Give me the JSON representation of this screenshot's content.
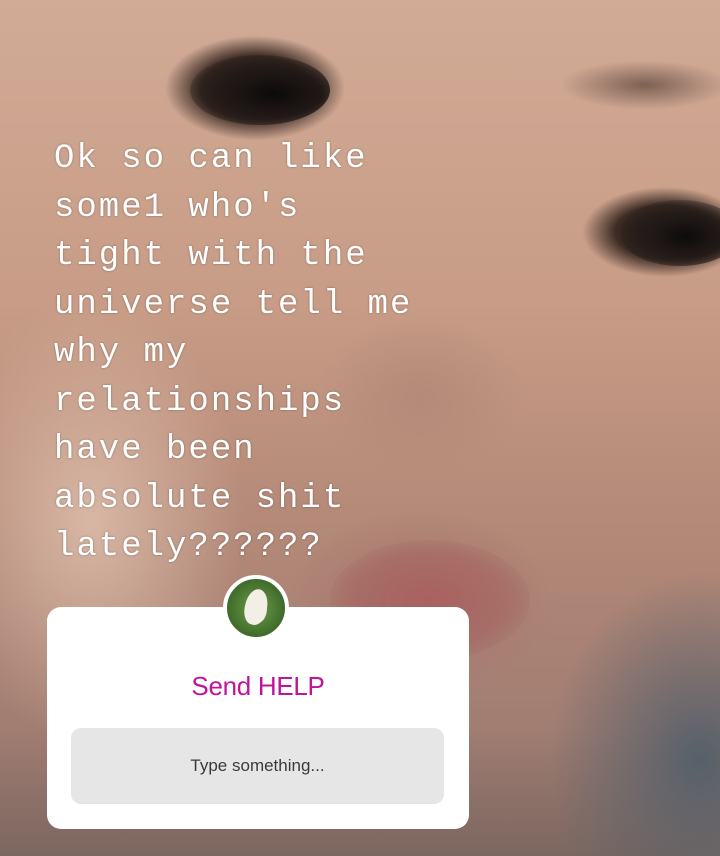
{
  "caption": {
    "text": "Ok so can like\nsome1 who's\ntight with the\nuniverse tell me\nwhy my\nrelationships\nhave been\nabsolute shit\nlately??????"
  },
  "question_sticker": {
    "prompt": "Send HELP",
    "input_placeholder": "Type something...",
    "prompt_color": "#c1139c"
  },
  "icons": {
    "avatar": "profile-avatar"
  }
}
